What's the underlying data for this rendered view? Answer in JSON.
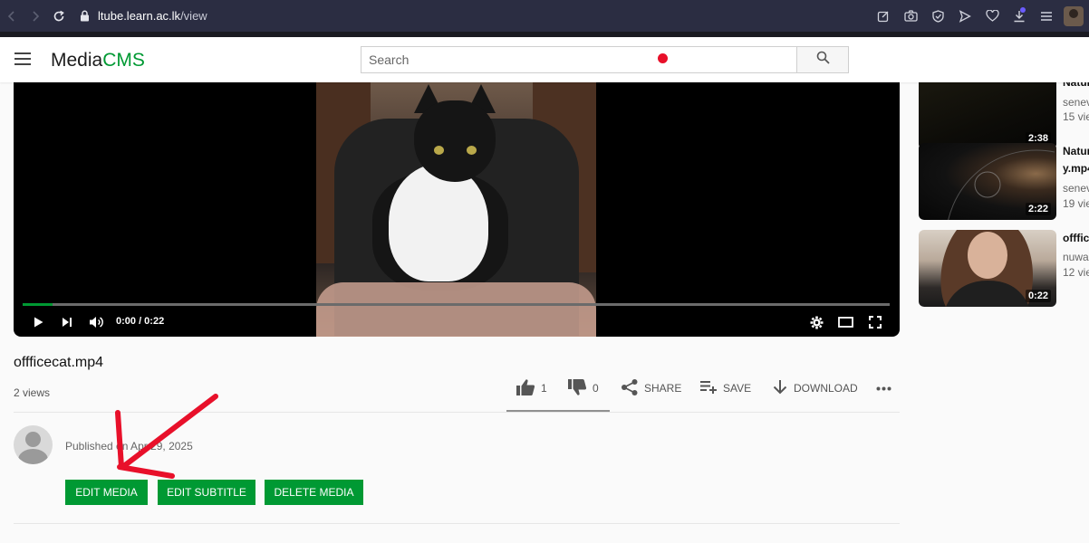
{
  "browser": {
    "url_domain": "ltube.learn.ac.lk",
    "url_path": "/view"
  },
  "header": {
    "logo_media": "Media",
    "logo_cms": "CMS",
    "search_placeholder": "Search"
  },
  "player": {
    "time": "0:00 / 0:22",
    "progress": 0.035
  },
  "media": {
    "title": "offficecat.mp4",
    "views": "2 views",
    "likes": "1",
    "dislikes": "0",
    "share_label": "SHARE",
    "save_label": "SAVE",
    "download_label": "DOWNLOAD",
    "published": "Published on Apr 29, 2025",
    "edit_media_label": "EDIT MEDIA",
    "edit_subtitle_label": "EDIT SUBTITLE",
    "delete_media_label": "DELETE MEDIA"
  },
  "sidebar": {
    "items": [
      {
        "title": "Natur",
        "title2": "",
        "author": "senev",
        "views": "15 vie",
        "duration": "2:38"
      },
      {
        "title": "Natur",
        "title2": "y.mp4",
        "author": "senev",
        "views": "19 vie",
        "duration": "2:22"
      },
      {
        "title": "offfic",
        "title2": "",
        "author": "nuwa",
        "views": "12 vie",
        "duration": "0:22"
      }
    ]
  },
  "colors": {
    "accent": "#009933",
    "browser_bar": "#2b2d42",
    "annotation_arrow": "#e8102a"
  }
}
